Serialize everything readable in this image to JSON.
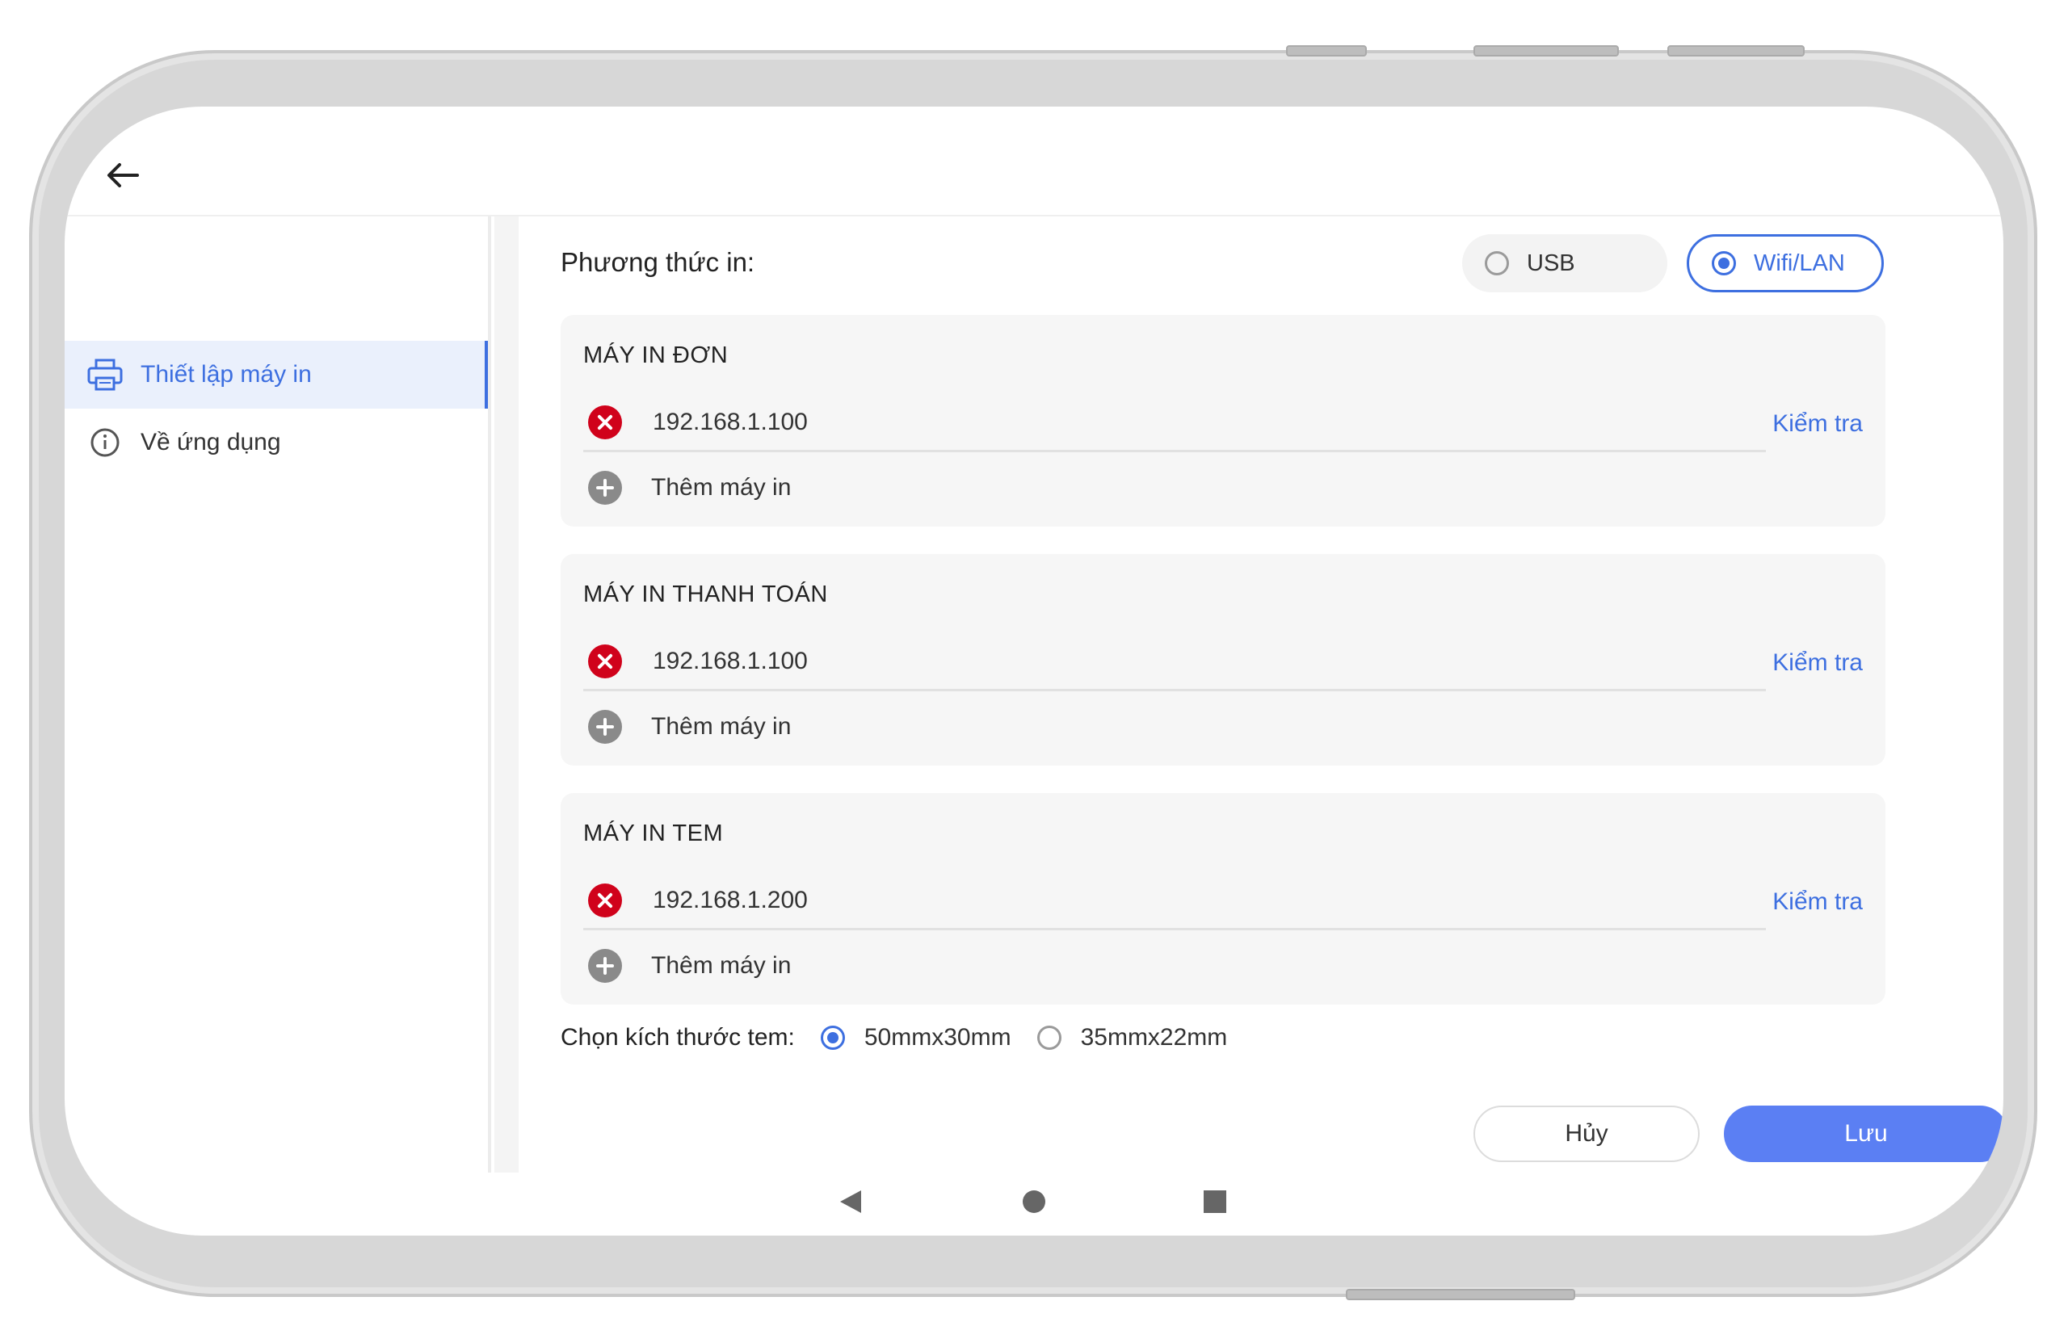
{
  "header": {
    "back_icon": "arrow-left-icon"
  },
  "sidebar": {
    "items": [
      {
        "label": "Thiết lập máy in",
        "icon": "printer-icon",
        "active": true
      },
      {
        "label": "Về ứng dụng",
        "icon": "info-icon",
        "active": false
      }
    ]
  },
  "print_method": {
    "label": "Phương thức in:",
    "options": [
      {
        "label": "USB",
        "selected": false
      },
      {
        "label": "Wifi/LAN",
        "selected": true
      }
    ]
  },
  "printer_groups": [
    {
      "title": "MÁY IN ĐƠN",
      "ip": "192.168.1.100",
      "check_label": "Kiểm tra",
      "add_label": "Thêm máy in"
    },
    {
      "title": "MÁY IN THANH TOÁN",
      "ip": "192.168.1.100",
      "check_label": "Kiểm tra",
      "add_label": "Thêm máy in"
    },
    {
      "title": "MÁY IN TEM",
      "ip": "192.168.1.200",
      "check_label": "Kiểm tra",
      "add_label": "Thêm máy in"
    }
  ],
  "label_size": {
    "label": "Chọn kích thước tem:",
    "options": [
      {
        "label": "50mmx30mm",
        "selected": true
      },
      {
        "label": "35mmx22mm",
        "selected": false
      }
    ]
  },
  "actions": {
    "cancel_label": "Hủy",
    "save_label": "Lưu"
  },
  "colors": {
    "accent": "#3d6fe0",
    "save_button": "#5b7ff3",
    "error": "#d0021b"
  }
}
